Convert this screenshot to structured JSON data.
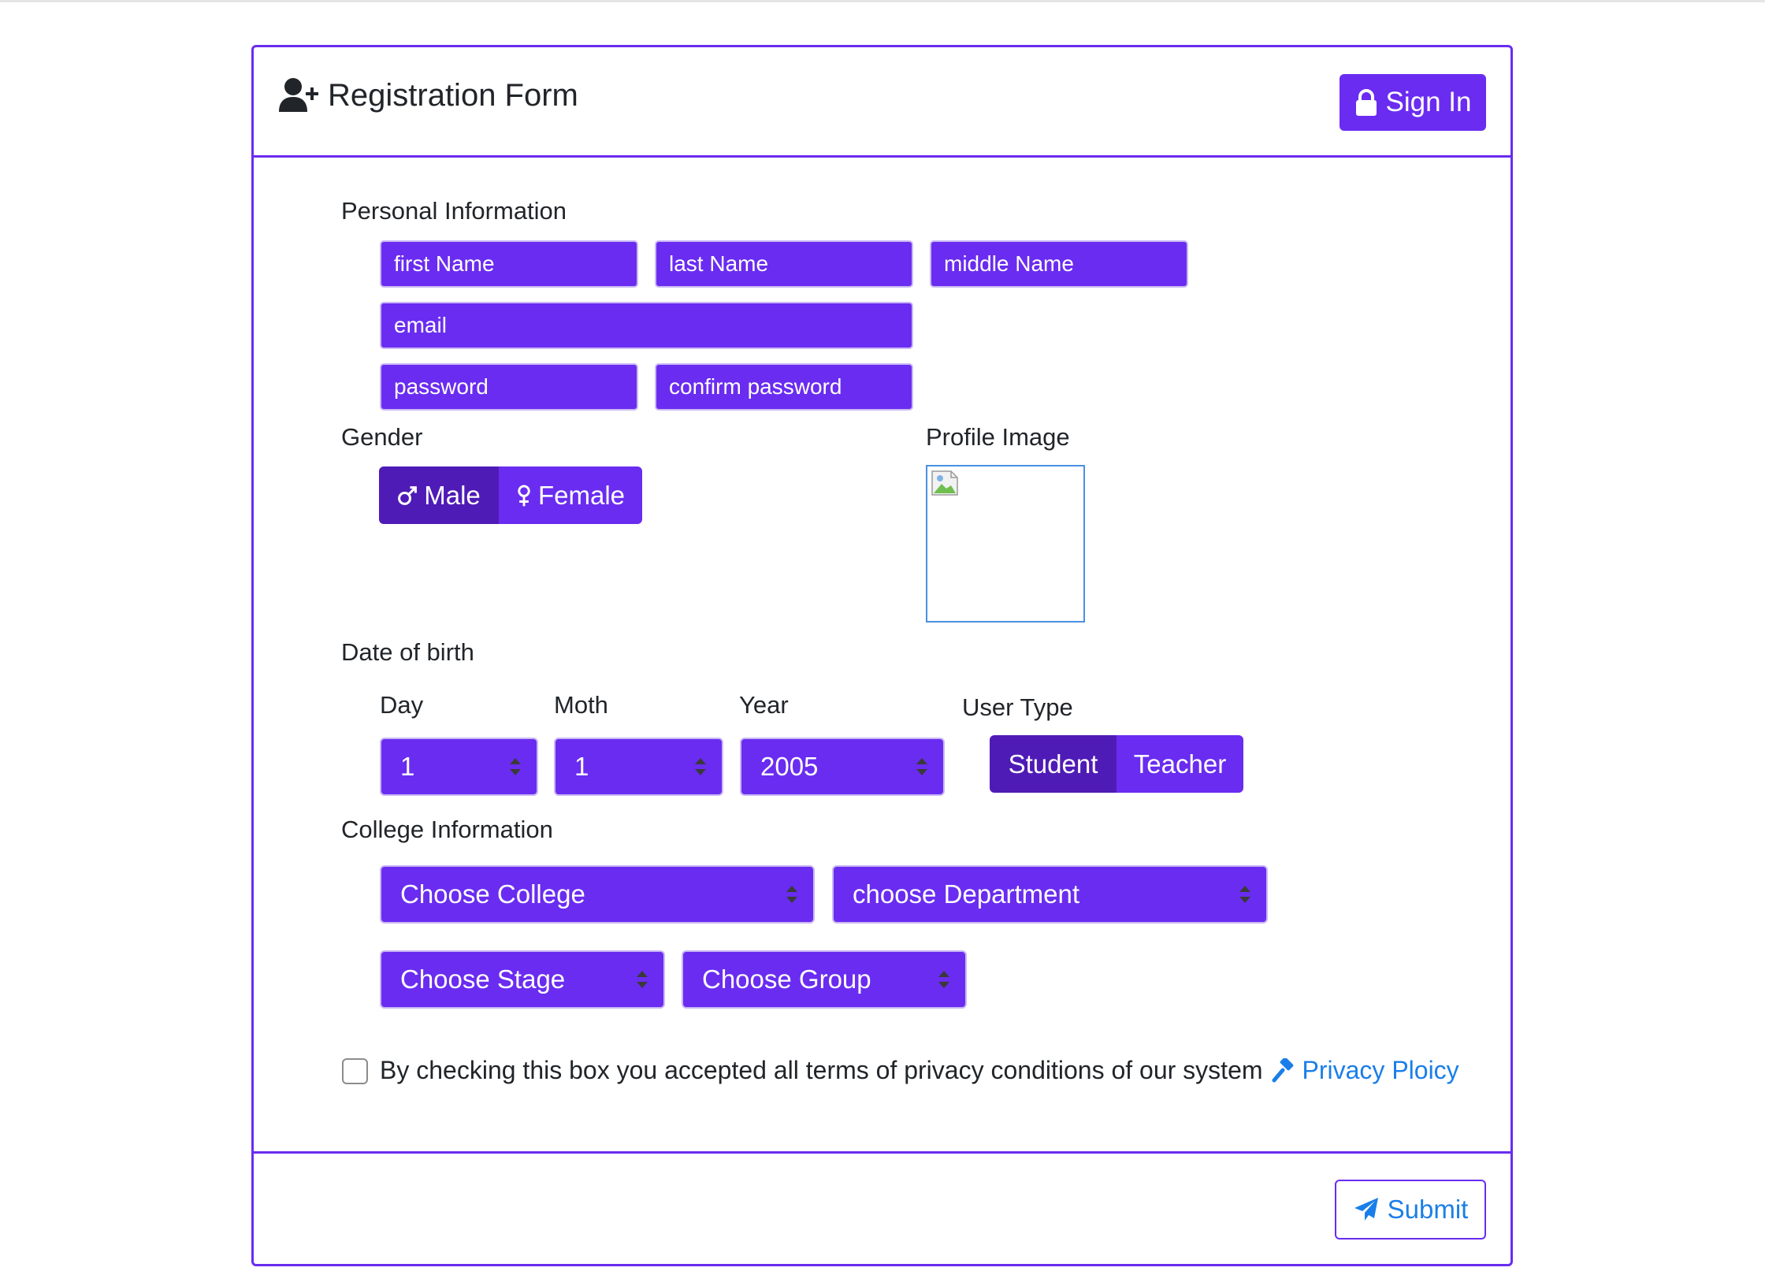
{
  "header": {
    "title": "Registration Form",
    "signin_label": "Sign In"
  },
  "personal": {
    "section_label": "Personal Information",
    "first_name_placeholder": "first Name",
    "last_name_placeholder": "last Name",
    "middle_name_placeholder": "middle Name",
    "email_placeholder": "email",
    "password_placeholder": "password",
    "confirm_password_placeholder": "confirm password"
  },
  "gender": {
    "label": "Gender",
    "male": "Male",
    "female": "Female",
    "selected": "Male"
  },
  "profile": {
    "label": "Profile Image"
  },
  "dob": {
    "label": "Date of birth",
    "day_label": "Day",
    "month_label": "Moth",
    "year_label": "Year",
    "day_value": "1",
    "month_value": "1",
    "year_value": "2005"
  },
  "user_type": {
    "label": "User Type",
    "student": "Student",
    "teacher": "Teacher",
    "selected": "Student"
  },
  "college": {
    "label": "College Information",
    "college_select": "Choose College",
    "department_select": "choose Department",
    "stage_select": "Choose Stage",
    "group_select": "Choose Group"
  },
  "terms": {
    "text": "By checking this box you accepted all terms of privacy conditions of our system",
    "privacy_link": "Privacy Ploicy",
    "checked": false
  },
  "footer": {
    "submit_label": "Submit"
  },
  "colors": {
    "primary": "#6a2cf0",
    "primary_active": "#4f1bb6",
    "link": "#1a7ee8"
  }
}
